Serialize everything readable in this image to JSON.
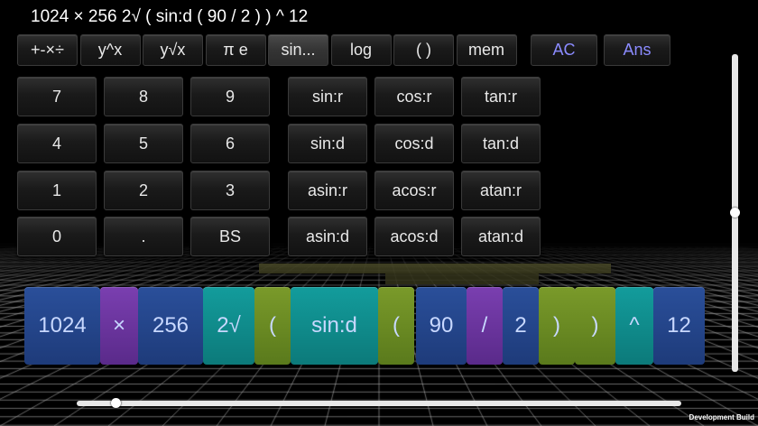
{
  "expression": "1024 × 256 2√ ( sin:d ( 90 / 2 ) ) ^ 12",
  "tabs": [
    {
      "label": "+-×÷",
      "name": "tab-operators",
      "selected": false
    },
    {
      "label": "y^x",
      "name": "tab-power",
      "selected": false
    },
    {
      "label": "y√x",
      "name": "tab-root",
      "selected": false
    },
    {
      "label": "π e",
      "name": "tab-constants",
      "selected": false
    },
    {
      "label": "sin...",
      "name": "tab-trig",
      "selected": true
    },
    {
      "label": "log",
      "name": "tab-log",
      "selected": false
    },
    {
      "label": "( )",
      "name": "tab-parentheses",
      "selected": false
    },
    {
      "label": "mem",
      "name": "tab-memory",
      "selected": false
    }
  ],
  "actions": {
    "clear": "AC",
    "answer": "Ans"
  },
  "keypad": [
    "7",
    "8",
    "9",
    "4",
    "5",
    "6",
    "1",
    "2",
    "3",
    "0",
    ".",
    "BS"
  ],
  "trig_keys": [
    "sin:r",
    "cos:r",
    "tan:r",
    "sin:d",
    "cos:d",
    "tan:d",
    "asin:r",
    "acos:r",
    "atan:r",
    "asin:d",
    "acos:d",
    "atan:d"
  ],
  "tokens": [
    {
      "text": "1024",
      "color": "blue"
    },
    {
      "text": "×",
      "color": "purple"
    },
    {
      "text": "256",
      "color": "blue"
    },
    {
      "text": "2√",
      "color": "teal"
    },
    {
      "text": "(",
      "color": "green"
    },
    {
      "text": "sin:d",
      "color": "teal"
    },
    {
      "text": "(",
      "color": "green"
    },
    {
      "text": "90",
      "color": "blue"
    },
    {
      "text": "/",
      "color": "purple"
    },
    {
      "text": "2",
      "color": "blue"
    },
    {
      "text": ")",
      "color": "green"
    },
    {
      "text": ")",
      "color": "green"
    },
    {
      "text": "^",
      "color": "teal"
    },
    {
      "text": "12",
      "color": "blue"
    }
  ],
  "footer": {
    "build_label": "Development Build"
  },
  "sliders": {
    "vertical_value": 0.5,
    "horizontal_value": 0.06
  },
  "colors": {
    "accent": "#8b8bff",
    "background": "#000000"
  }
}
